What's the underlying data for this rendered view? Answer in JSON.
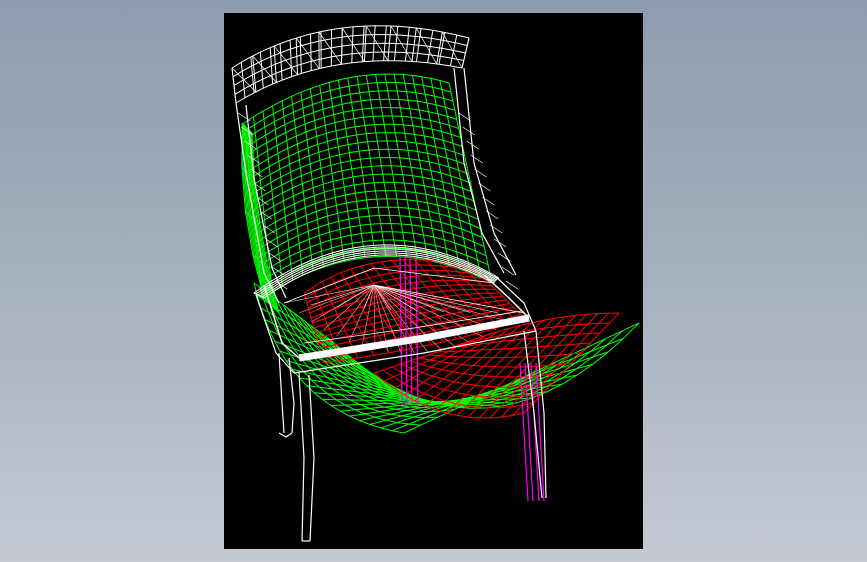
{
  "viewport": {
    "background": "#000000",
    "render_style": "wireframe"
  },
  "model": {
    "object": "chair",
    "layers": [
      {
        "part": "frame-and-back-rail",
        "color": "#ffffff"
      },
      {
        "part": "backrest-and-seat-shell",
        "color": "#00ff00"
      },
      {
        "part": "seat-cushion",
        "color": "#ff0000"
      },
      {
        "part": "rear-legs",
        "color": "#ff00ff"
      }
    ]
  },
  "page_background": {
    "top": "#8e9bb0",
    "bottom": "#c5cad3"
  }
}
